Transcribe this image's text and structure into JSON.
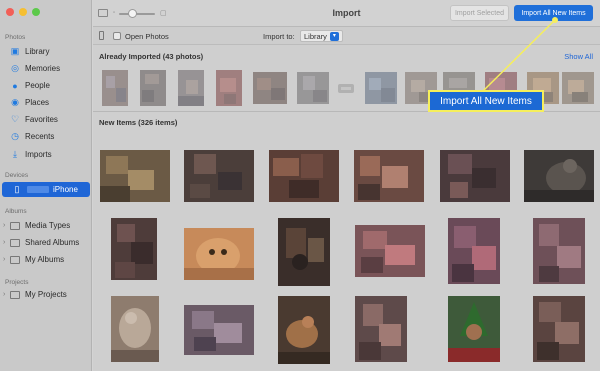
{
  "window": {
    "title": "Import"
  },
  "sidebar": {
    "sections": {
      "photos": "Photos",
      "devices": "Devices",
      "albums": "Albums",
      "projects": "Projects"
    },
    "photos_items": [
      {
        "label": "Library",
        "icon": "photo-library-icon"
      },
      {
        "label": "Memories",
        "icon": "memories-icon"
      },
      {
        "label": "People",
        "icon": "people-icon"
      },
      {
        "label": "Places",
        "icon": "places-icon"
      },
      {
        "label": "Favorites",
        "icon": "heart-icon"
      },
      {
        "label": "Recents",
        "icon": "clock-icon"
      },
      {
        "label": "Imports",
        "icon": "import-icon"
      }
    ],
    "device_item": {
      "label": "iPhone",
      "icon": "phone-icon",
      "selected": true
    },
    "album_items": [
      {
        "label": "Media Types",
        "icon": "folder-icon"
      },
      {
        "label": "Shared Albums",
        "icon": "folder-icon"
      },
      {
        "label": "My Albums",
        "icon": "folder-icon"
      }
    ],
    "project_items": [
      {
        "label": "My Projects",
        "icon": "folder-icon"
      }
    ]
  },
  "toolbar": {
    "import_selected_label": "Import Selected",
    "import_all_label": "Import All New Items",
    "open_photos_label": "Open Photos",
    "import_to_label": "Import to:",
    "import_to_value": "Library"
  },
  "sections": {
    "already_imported": "Already Imported (43 photos)",
    "show_all": "Show All",
    "new_items": "New Items (326 items)"
  },
  "callout": {
    "label": "Import All New Items"
  },
  "colors": {
    "accent": "#1f6fd9",
    "callout_border": "#f6ef5b",
    "sidebar_bg": "#c9c9c9"
  },
  "thumbnails": {
    "already_imported_count_visible": 12,
    "new_items_count_visible": 18
  }
}
